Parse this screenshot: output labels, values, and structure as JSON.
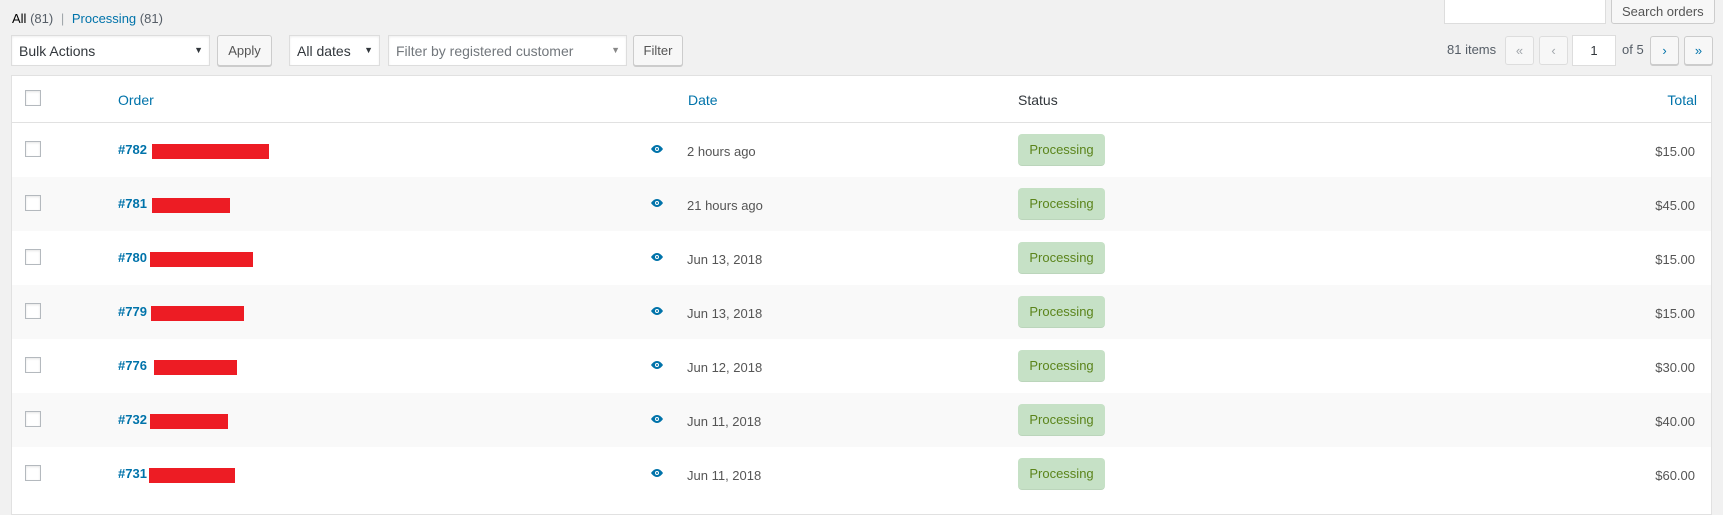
{
  "views": [
    {
      "label": "All",
      "count": "(81)"
    },
    {
      "label": "Processing",
      "count": "(81)"
    }
  ],
  "search": {
    "value": "",
    "button": "Search orders"
  },
  "bulk_actions": {
    "selected": "Bulk Actions",
    "apply": "Apply"
  },
  "date_filter": {
    "selected": "All dates"
  },
  "customer_filter": {
    "placeholder": "Filter by registered customer"
  },
  "filter_button": "Filter",
  "pagination": {
    "items": "81 items",
    "first": "«",
    "prev": "‹",
    "next": "›",
    "last": "»",
    "current_page": "1",
    "of": "of 5"
  },
  "columns": {
    "order": "Order",
    "date": "Date",
    "status": "Status",
    "total": "Total"
  },
  "colors": {
    "accent": "#0073aa",
    "status_bg": "#c6e1c6",
    "status_text": "#5b841b",
    "redaction": "#ed1c24"
  },
  "orders": [
    {
      "number": "#782",
      "date": "2 hours ago",
      "status": "Processing",
      "total": "$15.00",
      "icon": "eye-icon"
    },
    {
      "number": "#781",
      "date": "21 hours ago",
      "status": "Processing",
      "total": "$45.00",
      "icon": "eye-icon"
    },
    {
      "number": "#780",
      "date": "Jun 13, 2018",
      "status": "Processing",
      "total": "$15.00",
      "icon": "eye-icon"
    },
    {
      "number": "#779",
      "date": "Jun 13, 2018",
      "status": "Processing",
      "total": "$15.00",
      "icon": "eye-icon"
    },
    {
      "number": "#776",
      "date": "Jun 12, 2018",
      "status": "Processing",
      "total": "$30.00",
      "icon": "eye-icon"
    },
    {
      "number": "#732",
      "date": "Jun 11, 2018",
      "status": "Processing",
      "total": "$40.00",
      "icon": "eye-icon"
    },
    {
      "number": "#731",
      "date": "Jun 11, 2018",
      "status": "Processing",
      "total": "$60.00",
      "icon": "eye-icon"
    }
  ]
}
